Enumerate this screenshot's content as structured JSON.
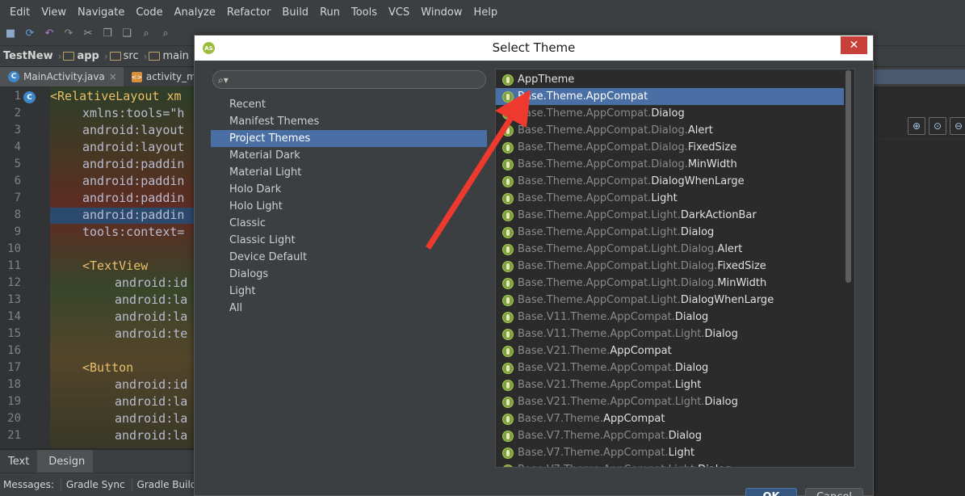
{
  "menu": [
    "Edit",
    "View",
    "Navigate",
    "Code",
    "Analyze",
    "Refactor",
    "Build",
    "Run",
    "Tools",
    "VCS",
    "Window",
    "Help"
  ],
  "breadcrumb": {
    "project": "TestNew",
    "module": "app",
    "src": "src",
    "main": "main"
  },
  "tabs": {
    "main_activity": "MainActivity.java",
    "activity_main": "activity_m"
  },
  "editor": {
    "line_numbers": [
      "1",
      "2",
      "3",
      "4",
      "5",
      "6",
      "7",
      "8",
      "9",
      "10",
      "11",
      "12",
      "13",
      "14",
      "15",
      "16",
      "17",
      "18",
      "19",
      "20",
      "21"
    ],
    "lines": [
      "<RelativeLayout xm",
      "xmlns:tools=\"h",
      "android:layout",
      "android:layout",
      "android:paddin",
      "android:paddin",
      "android:paddin",
      "android:paddin",
      "tools:context=",
      "",
      "<TextView",
      "android:id",
      "android:la",
      "android:la",
      "android:te",
      "",
      "<Button",
      "android:id",
      "android:la",
      "android:la",
      "android:la"
    ]
  },
  "bottom_tabs": {
    "text": "Text",
    "design": "Design"
  },
  "status": {
    "messages": "Messages:",
    "gradle_sync": "Gradle Sync",
    "gradle_build": "Gradle Build"
  },
  "dialog": {
    "title": "Select Theme",
    "search_placeholder": "",
    "categories": [
      "Recent",
      "Manifest Themes",
      "Project Themes",
      "Material Dark",
      "Material Light",
      "Holo Dark",
      "Holo Light",
      "Classic",
      "Classic Light",
      "Device Default",
      "Dialogs",
      "Light",
      "All"
    ],
    "selected_category": "Project Themes",
    "themes": [
      {
        "prefix": "",
        "suffix": "AppTheme"
      },
      {
        "prefix": "Base.Theme.AppCompat",
        "suffix": ""
      },
      {
        "prefix": "Base.Theme.AppCompat.",
        "suffix": "Dialog"
      },
      {
        "prefix": "Base.Theme.AppCompat.Dialog.",
        "suffix": "Alert"
      },
      {
        "prefix": "Base.Theme.AppCompat.Dialog.",
        "suffix": "FixedSize"
      },
      {
        "prefix": "Base.Theme.AppCompat.Dialog.",
        "suffix": "MinWidth"
      },
      {
        "prefix": "Base.Theme.AppCompat.",
        "suffix": "DialogWhenLarge"
      },
      {
        "prefix": "Base.Theme.AppCompat.",
        "suffix": "Light"
      },
      {
        "prefix": "Base.Theme.AppCompat.Light.",
        "suffix": "DarkActionBar"
      },
      {
        "prefix": "Base.Theme.AppCompat.Light.",
        "suffix": "Dialog"
      },
      {
        "prefix": "Base.Theme.AppCompat.Light.Dialog.",
        "suffix": "Alert"
      },
      {
        "prefix": "Base.Theme.AppCompat.Light.Dialog.",
        "suffix": "FixedSize"
      },
      {
        "prefix": "Base.Theme.AppCompat.Light.Dialog.",
        "suffix": "MinWidth"
      },
      {
        "prefix": "Base.Theme.AppCompat.Light.",
        "suffix": "DialogWhenLarge"
      },
      {
        "prefix": "Base.V11.Theme.AppCompat.",
        "suffix": "Dialog"
      },
      {
        "prefix": "Base.V11.Theme.AppCompat.Light.",
        "suffix": "Dialog"
      },
      {
        "prefix": "Base.V21.Theme.",
        "suffix": "AppCompat"
      },
      {
        "prefix": "Base.V21.Theme.AppCompat.",
        "suffix": "Dialog"
      },
      {
        "prefix": "Base.V21.Theme.AppCompat.",
        "suffix": "Light"
      },
      {
        "prefix": "Base.V21.Theme.AppCompat.Light.",
        "suffix": "Dialog"
      },
      {
        "prefix": "Base.V7.Theme.",
        "suffix": "AppCompat"
      },
      {
        "prefix": "Base.V7.Theme.AppCompat.",
        "suffix": "Dialog"
      },
      {
        "prefix": "Base.V7.Theme.AppCompat.",
        "suffix": "Light"
      },
      {
        "prefix": "Base.V7.Theme.AppCompat.Light.",
        "suffix": "Dialog"
      }
    ],
    "selected_theme": "Base.Theme.AppCompat",
    "ok_label": "OK",
    "cancel_label": "Cancel"
  },
  "colors": {
    "selection": "#4a6fa5",
    "annotation_arrow": "#ee3a2e",
    "theme_icon": "#7ca03a"
  }
}
